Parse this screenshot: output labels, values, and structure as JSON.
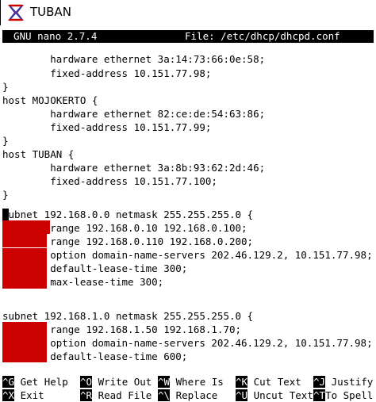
{
  "window": {
    "title": "TUBAN",
    "icon": "tuban-app-icon"
  },
  "nano": {
    "version": "GNU nano 2.7.4",
    "file_label": "File: /etc/dhcp/dhcpd.conf"
  },
  "lines": [
    "        hardware ethernet 3a:14:73:66:0e:58;",
    "        fixed-address 10.151.77.98;",
    "}",
    "host MOJOKERTO {",
    "        hardware ethernet 82:ce:de:54:63:86;",
    "        fixed-address 10.151.77.99;",
    "}",
    "host TUBAN {",
    "        hardware ethernet 3a:8b:93:62:2d:46;",
    "        fixed-address 10.151.77.100;",
    "}",
    "",
    "subnet 192.168.0.0 netmask 255.255.255.0 {",
    "        range 192.168.0.10 192.168.0.100;",
    "        range 192.168.0.110 192.168.0.200;",
    "        option domain-name-servers 202.46.129.2, 10.151.77.98;",
    "        default-lease-time 300;",
    "        max-lease-time 300;",
    "",
    "subnet 192.168.1.0 netmask 255.255.255.0 {",
    "        range 192.168.1.50 192.168.1.70;",
    "        option domain-name-servers 202.46.129.2, 10.151.77.98;",
    "        default-lease-time 600;"
  ],
  "shortcuts": [
    {
      "key": "^G",
      "label": "Get Help"
    },
    {
      "key": "^O",
      "label": "Write Out"
    },
    {
      "key": "^W",
      "label": "Where Is"
    },
    {
      "key": "^K",
      "label": "Cut Text"
    },
    {
      "key": "^J",
      "label": "Justify"
    },
    {
      "key": "^X",
      "label": "Exit"
    },
    {
      "key": "^R",
      "label": "Read File"
    },
    {
      "key": "^\\",
      "label": "Replace"
    },
    {
      "key": "^U",
      "label": "Uncut Text"
    },
    {
      "key": "^T",
      "label": "To Spell"
    }
  ],
  "colors": {
    "redaction": "#cc0000",
    "header_bg": "#000000",
    "text": "#000000"
  }
}
